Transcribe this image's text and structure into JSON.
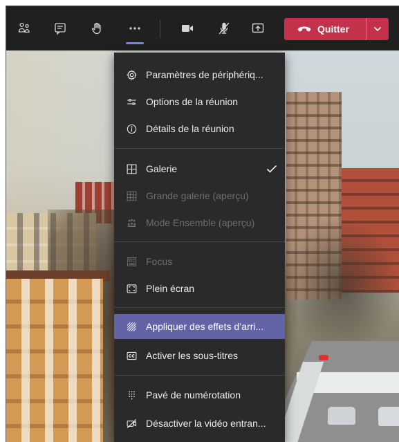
{
  "toolbar": {
    "people_icon": "people-icon",
    "chat_icon": "chat-icon",
    "raise_hand_icon": "raise-hand-icon",
    "more_icon": "more-actions-icon",
    "camera_icon": "camera-icon",
    "mic_icon": "mic-off-icon",
    "share_icon": "share-screen-icon",
    "quit_label": "Quitter",
    "quit_color": "#c4314b"
  },
  "menu": {
    "accent": "#6264a7",
    "items": [
      {
        "label": "Paramètres de périphériq...",
        "icon": "gear-icon",
        "enabled": true
      },
      {
        "label": "Options de la réunion",
        "icon": "sliders-icon",
        "enabled": true
      },
      {
        "label": "Détails de la réunion",
        "icon": "info-icon",
        "enabled": true
      },
      {
        "label": "Galerie",
        "icon": "gallery-icon",
        "enabled": true,
        "checked": true
      },
      {
        "label": "Grande galerie (aperçu)",
        "icon": "large-gallery-icon",
        "enabled": false
      },
      {
        "label": "Mode Ensemble (aperçu)",
        "icon": "together-mode-icon",
        "enabled": false
      },
      {
        "label": "Focus",
        "icon": "focus-icon",
        "enabled": false
      },
      {
        "label": "Plein écran",
        "icon": "fullscreen-icon",
        "enabled": true
      },
      {
        "label": "Appliquer des effets d’arri...",
        "icon": "background-effects-icon",
        "enabled": true,
        "highlighted": true
      },
      {
        "label": "Activer les sous-titres",
        "icon": "captions-icon",
        "enabled": true
      },
      {
        "label": "Pavé de numérotation",
        "icon": "dialpad-icon",
        "enabled": true
      },
      {
        "label": "Désactiver la vidéo entran...",
        "icon": "video-off-icon",
        "enabled": true
      }
    ]
  }
}
